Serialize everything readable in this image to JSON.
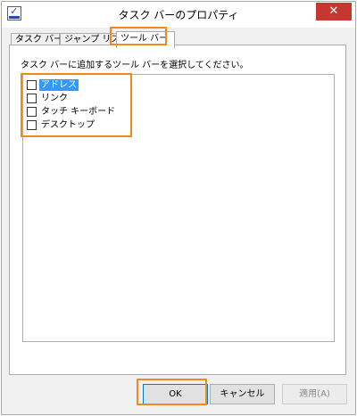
{
  "window": {
    "title": "タスク バーのプロパティ",
    "close_label": "✕"
  },
  "tabs": [
    {
      "label": "タスク バー"
    },
    {
      "label": "ジャンプ リスト"
    },
    {
      "label": "ツール バー",
      "active": true
    }
  ],
  "panel": {
    "instruction": "タスク バーに追加するツール バーを選択してください。",
    "toolbars": [
      {
        "label": "アドレス",
        "checked": false,
        "selected": true
      },
      {
        "label": "リンク",
        "checked": false,
        "selected": false
      },
      {
        "label": "タッチ キーボード",
        "checked": false,
        "selected": false
      },
      {
        "label": "デスクトップ",
        "checked": false,
        "selected": false
      }
    ]
  },
  "buttons": {
    "ok": "OK",
    "cancel": "キャンセル",
    "apply": "適用(A)"
  },
  "colors": {
    "highlight": "#f28a1b",
    "selection": "#3399ff",
    "close": "#c7372f"
  }
}
